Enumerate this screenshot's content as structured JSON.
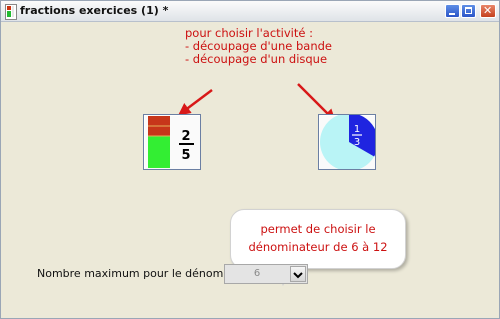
{
  "window": {
    "title": "fractions exercices (1) *",
    "icon": "app-fraction-icon",
    "controls": {
      "minimize": "minimize-icon",
      "maximize": "maximize-icon",
      "close": "close-icon"
    }
  },
  "annotations": {
    "activity_callout": [
      "pour choisir l'activité :",
      "- découpage d'une bande",
      "- découpage d'un disque"
    ],
    "denominator_bubble": [
      "permet de choisir le",
      "dénominateur de 6 à 12"
    ],
    "color": "#cc1111"
  },
  "activities": {
    "band": {
      "icon": "band-fraction-icon",
      "numerator": "2",
      "denominator": "5"
    },
    "disk": {
      "icon": "disk-fraction-icon",
      "numerator": "1",
      "denominator": "3"
    }
  },
  "denominator": {
    "label": "Nombre maximum pour le dénominateur :",
    "selected": "6",
    "dropdown_icon": "chevron-down-icon"
  }
}
